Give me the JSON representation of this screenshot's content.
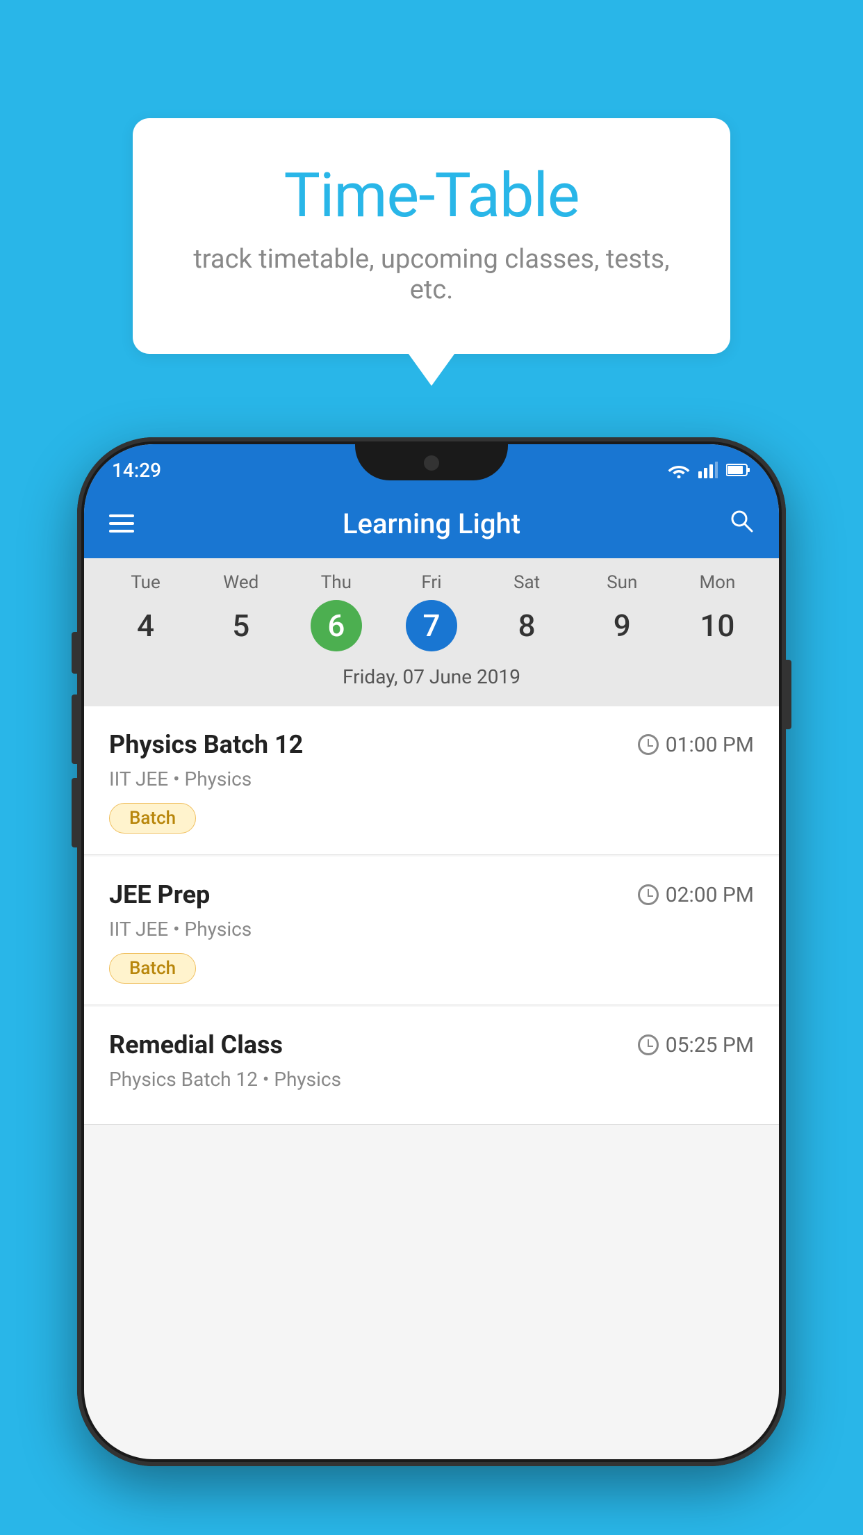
{
  "background_color": "#29B6E8",
  "tooltip": {
    "title": "Time-Table",
    "subtitle": "track timetable, upcoming classes, tests, etc."
  },
  "phone": {
    "status_bar": {
      "time": "14:29"
    },
    "app_bar": {
      "title": "Learning Light"
    },
    "calendar": {
      "days": [
        {
          "name": "Tue",
          "num": "4",
          "style": "normal"
        },
        {
          "name": "Wed",
          "num": "5",
          "style": "normal"
        },
        {
          "name": "Thu",
          "num": "6",
          "style": "green"
        },
        {
          "name": "Fri",
          "num": "7",
          "style": "blue"
        },
        {
          "name": "Sat",
          "num": "8",
          "style": "normal"
        },
        {
          "name": "Sun",
          "num": "9",
          "style": "normal"
        },
        {
          "name": "Mon",
          "num": "10",
          "style": "normal"
        }
      ],
      "selected_date": "Friday, 07 June 2019"
    },
    "schedule": [
      {
        "title": "Physics Batch 12",
        "time": "01:00 PM",
        "meta": "IIT JEE • Physics",
        "tag": "Batch"
      },
      {
        "title": "JEE Prep",
        "time": "02:00 PM",
        "meta": "IIT JEE • Physics",
        "tag": "Batch"
      },
      {
        "title": "Remedial Class",
        "time": "05:25 PM",
        "meta": "Physics Batch 12 • Physics",
        "tag": ""
      }
    ]
  }
}
